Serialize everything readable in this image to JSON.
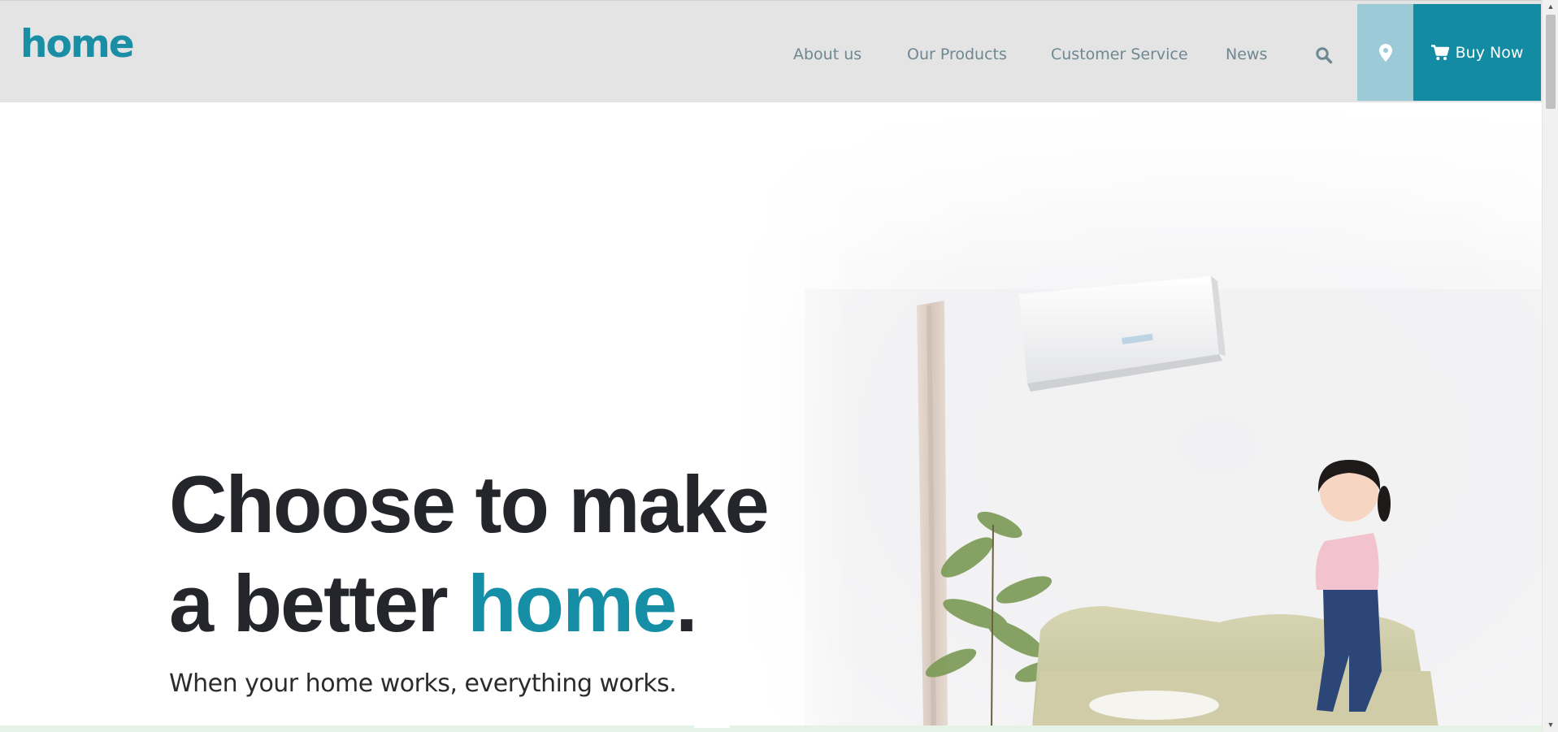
{
  "header": {
    "logo": "home",
    "nav": {
      "about": "About us",
      "products": "Our Products",
      "service": "Customer Service",
      "news": "News"
    },
    "buy_now": "Buy Now"
  },
  "hero": {
    "title_line1": "Choose to make",
    "title_line2_prefix": "a better ",
    "title_accent": "home",
    "title_suffix": ".",
    "subtitle": "When your home works, everything works."
  },
  "colors": {
    "brand": "#128ba3",
    "brand_light": "#9ccad7",
    "header_bg": "#e4e4e5",
    "nav_text": "#6e8791",
    "title_text": "#24262b"
  },
  "icons": [
    "search-icon",
    "map-pin-icon",
    "cart-icon"
  ]
}
